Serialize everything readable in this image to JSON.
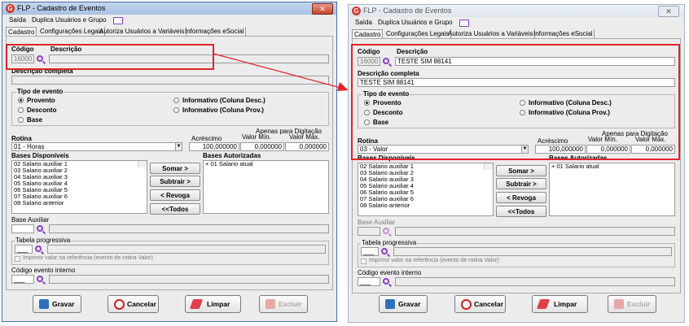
{
  "app": {
    "title": "FLP - Cadastro de Eventos",
    "icon_letter": "G"
  },
  "menu": {
    "saida": "Saída",
    "duplica": "Duplica Usuários e Grupo"
  },
  "tabs": [
    "Cadastro",
    "Configurações Legais",
    "Autoriza Usuários a Variáveis",
    "Informações eSocial"
  ],
  "labels": {
    "codigo": "Código",
    "descricao": "Descrição",
    "descricao_completa": "Descrição completa",
    "tipo_evento": "Tipo de evento",
    "rotina": "Rotina",
    "acrescimo": "Acréscimo",
    "valor_min": "Valor Mín.",
    "valor_max": "Valor Máx.",
    "apenas_digitacao": "Apenas para Digitação",
    "bases_disponiveis": "Bases Disponíveis",
    "bases_autorizadas": "Bases Autorizadas",
    "base_auxiliar": "Base Auxiliar",
    "tabela_progressiva": "Tabela progressiva",
    "imprimir_valor": "Imprimir valor na referência (evento de rotina Valor)",
    "codigo_evento_interno": "Código evento interno"
  },
  "radios": {
    "provento": "Provento",
    "desconto": "Desconto",
    "base": "Base",
    "inf_desc": "Informativo (Coluna Desc.)",
    "inf_prov": "Informativo (Coluna Prov.)"
  },
  "transfer_buttons": {
    "somar": "Somar >",
    "subtrair": "Subtrair >",
    "revoga": "< Revoga",
    "todos": "<<Todos"
  },
  "actions": {
    "gravar": "Gravar",
    "cancelar": "Cancelar",
    "limpar": "Limpar",
    "excluir": "Excluir"
  },
  "left_form": {
    "codigo": "16000",
    "descricao": "",
    "descricao_completa": "",
    "rotina": "01 - Horas",
    "acrescimo": "100,000000",
    "valor_min": "0,000000",
    "valor_max": "0,000000",
    "bases_disponiveis": [
      "02 Salario auxiliar 1",
      "03 Salario auxiliar 2",
      "04 Salario auxiliar 3",
      "05 Salario auxiliar 4",
      "06 Salario auxiliar 5",
      "07 Salario auxiliar 6",
      "08 Salario anterior"
    ],
    "bases_autorizadas": [
      "+ 01 Salario atual"
    ],
    "tabela_codigo": "___",
    "interno_codigo": "___"
  },
  "right_form": {
    "codigo": "16000",
    "descricao": "TESTE SIM 88141",
    "descricao_completa": "TESTE SIM 88141",
    "rotina": "03 - Valor",
    "acrescimo": "100,000000",
    "valor_min": "0,000000",
    "valor_max": "0,000000",
    "bases_disponiveis": [
      "02 Salario auxiliar 1",
      "03 Salario auxiliar 2",
      "04 Salario auxiliar 3",
      "05 Salario auxiliar 4",
      "06 Salario auxiliar 5",
      "07 Salario auxiliar 6",
      "08 Salario anterior"
    ],
    "bases_autorizadas": [
      "+ 01 Salario atual"
    ],
    "tabela_codigo": "___",
    "interno_codigo": "___"
  },
  "colors": {
    "highlight": "#e0232a",
    "accent": "#8b3fc7"
  }
}
